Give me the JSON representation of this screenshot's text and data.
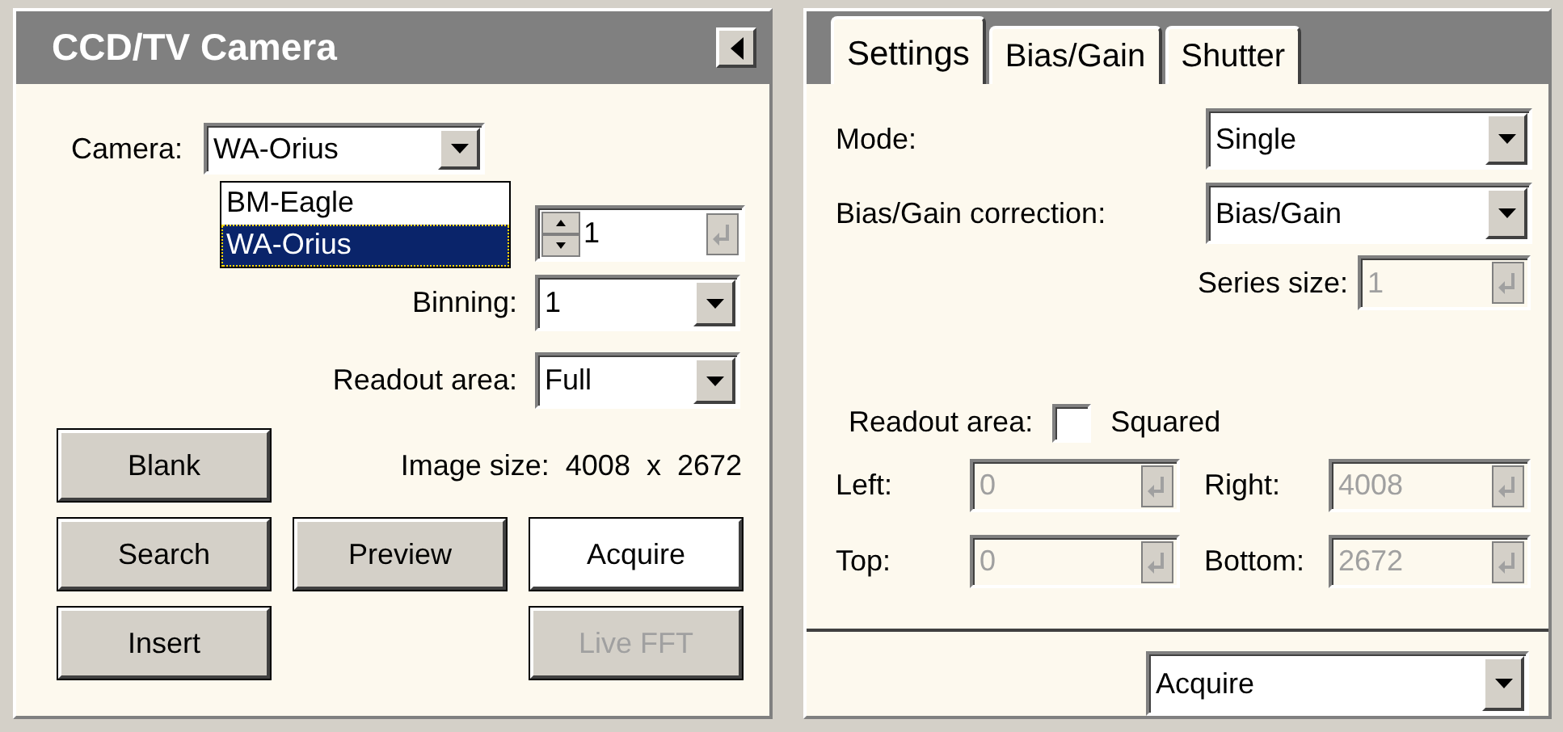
{
  "camera_panel": {
    "title": "CCD/TV Camera",
    "camera": {
      "label": "Camera:",
      "value": "WA-Orius",
      "expanded": true,
      "options": [
        {
          "label": "BM-Eagle",
          "selected": false
        },
        {
          "label": "WA-Orius",
          "selected": true
        }
      ]
    },
    "exposure": {
      "value": "1"
    },
    "binning": {
      "label": "Binning:",
      "value": "1"
    },
    "readout_area": {
      "label": "Readout area:",
      "value": "Full"
    },
    "image_size": {
      "label": "Image size:",
      "value": "4008  x  2672"
    },
    "buttons": [
      {
        "label": "Blank",
        "default": false,
        "disabled": false
      },
      {
        "label": "Search",
        "default": false,
        "disabled": false
      },
      {
        "label": "Preview",
        "default": false,
        "disabled": false
      },
      {
        "label": "Acquire",
        "default": true,
        "disabled": false
      },
      {
        "label": "Insert",
        "default": false,
        "disabled": false
      },
      {
        "label": "Live FFT",
        "default": false,
        "disabled": true
      }
    ]
  },
  "settings_panel": {
    "tabs": [
      {
        "label": "Settings",
        "selected": true
      },
      {
        "label": "Bias/Gain",
        "selected": false
      },
      {
        "label": "Shutter",
        "selected": false
      }
    ],
    "mode": {
      "label": "Mode:",
      "value": "Single"
    },
    "bias_gain_correction": {
      "label": "Bias/Gain correction:",
      "value": "Bias/Gain"
    },
    "series_size": {
      "label": "Series size:",
      "value": "1",
      "disabled": true
    },
    "readout_area": {
      "label": "Readout area:",
      "checkbox_label": "Squared",
      "checked": false
    },
    "bounds": [
      {
        "label": "Left:",
        "value": "0",
        "disabled": true
      },
      {
        "label": "Right:",
        "value": "4008",
        "disabled": true
      },
      {
        "label": "Top:",
        "value": "0",
        "disabled": true
      },
      {
        "label": "Bottom:",
        "value": "2672",
        "disabled": true
      }
    ],
    "action": {
      "value": "Acquire"
    }
  }
}
